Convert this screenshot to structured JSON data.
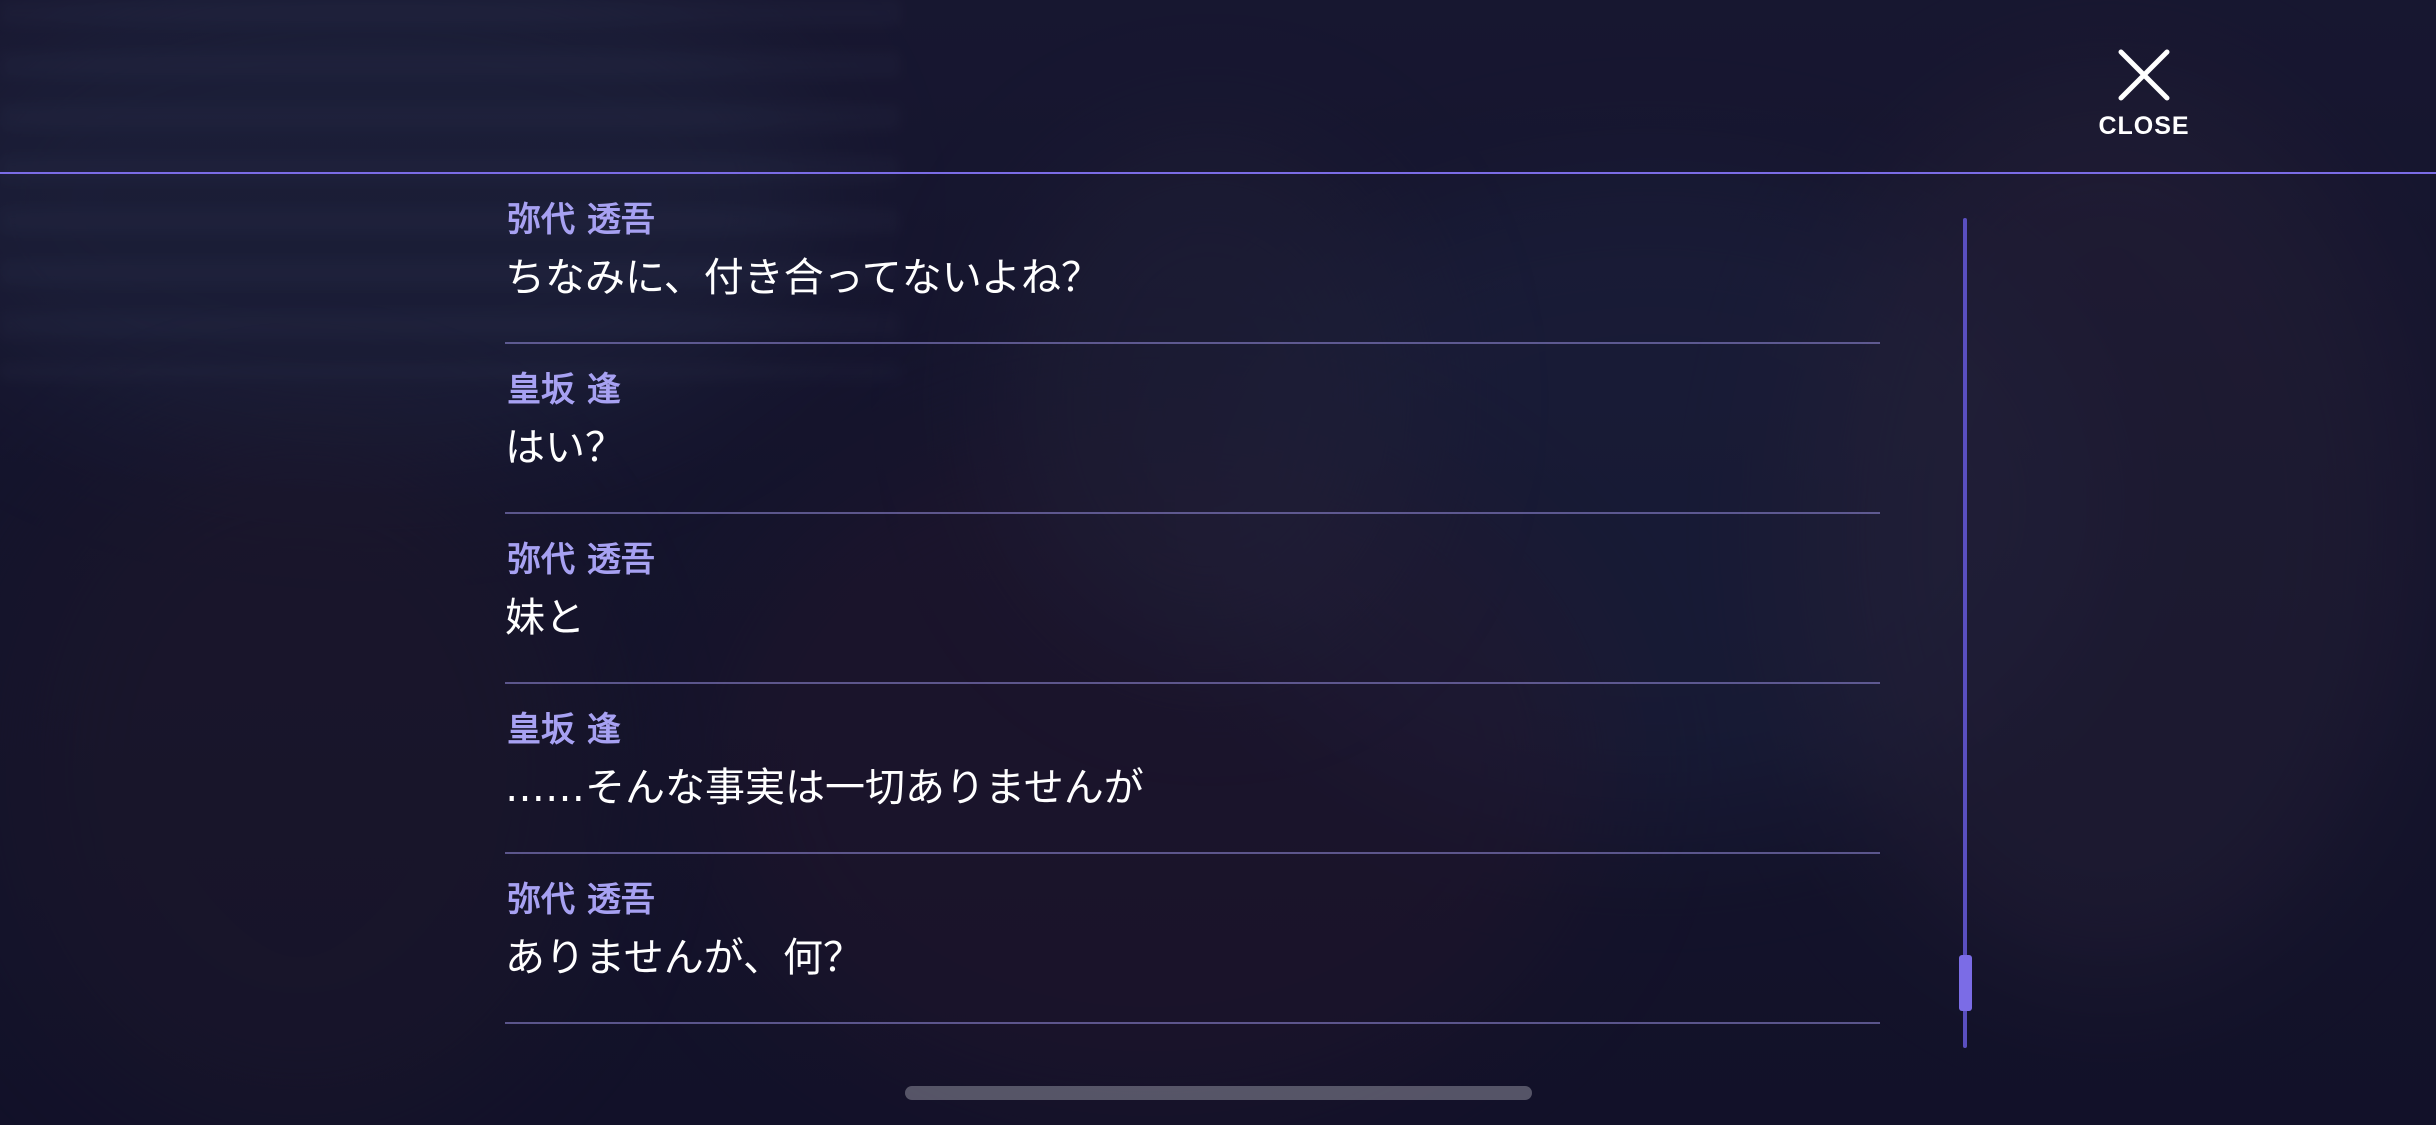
{
  "header": {
    "close_label": "CLOSE",
    "close_icon": "close-x-icon"
  },
  "log": {
    "entries": [
      {
        "speaker": "弥代 透吾",
        "text": "ちなみに、付き合ってないよね？"
      },
      {
        "speaker": "皇坂 逢",
        "text": "はい？"
      },
      {
        "speaker": "弥代 透吾",
        "text": "妹と"
      },
      {
        "speaker": "皇坂 逢",
        "text": "……そんな事実は一切ありませんが"
      },
      {
        "speaker": "弥代 透吾",
        "text": "ありませんが、何？"
      }
    ]
  },
  "scrollbar": {
    "position_fraction": 0.9
  },
  "colors": {
    "accent": "#7b6ce6",
    "speaker_name": "#a7a1f2",
    "text": "#ffffff",
    "background": "#15142a"
  }
}
